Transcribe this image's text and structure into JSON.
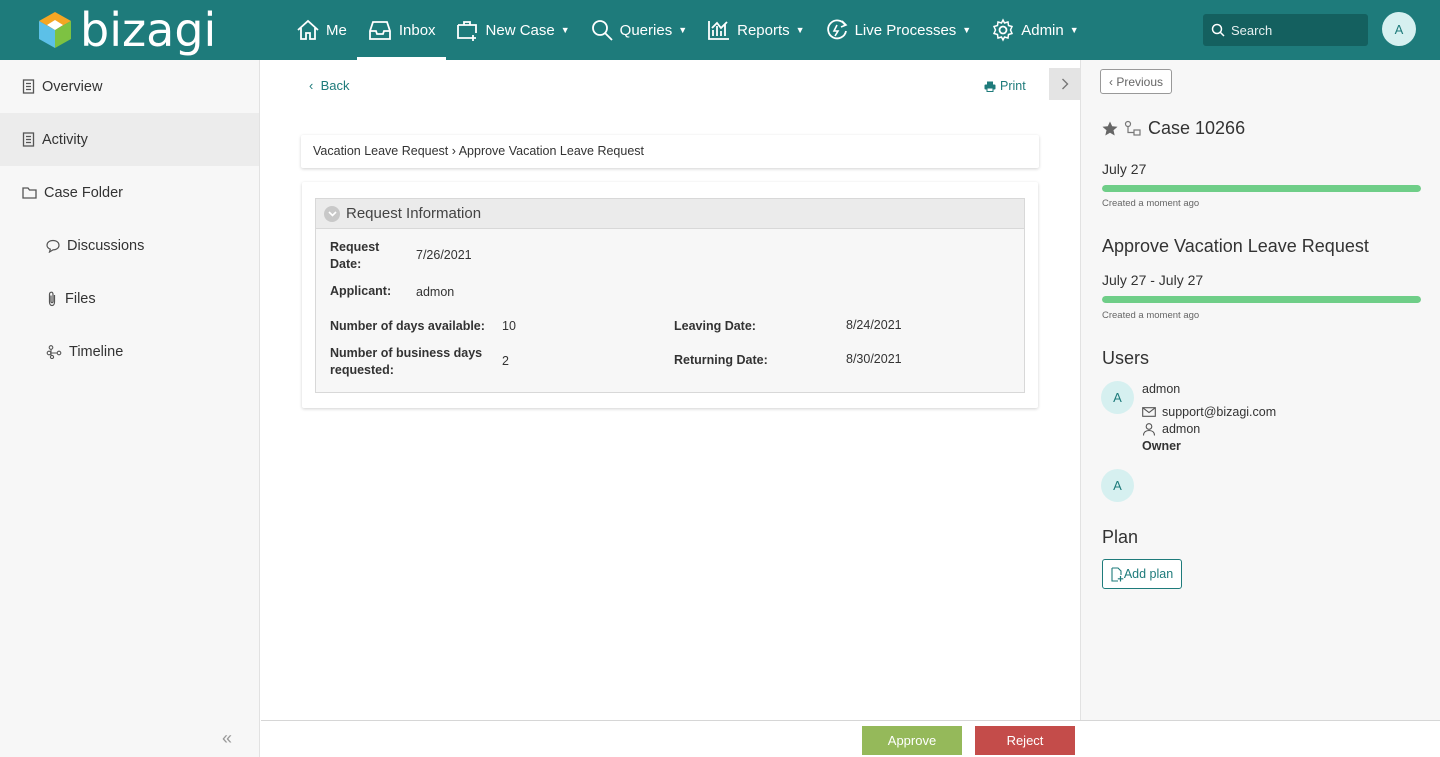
{
  "app": {
    "logo_text": "bizagi"
  },
  "nav": {
    "items": [
      {
        "label": "Me",
        "icon": "home-icon"
      },
      {
        "label": "Inbox",
        "icon": "inbox-icon",
        "active": true
      },
      {
        "label": "New Case",
        "icon": "new-case-icon",
        "dropdown": true
      },
      {
        "label": "Queries",
        "icon": "search-icon",
        "dropdown": true
      },
      {
        "label": "Reports",
        "icon": "reports-icon",
        "dropdown": true
      },
      {
        "label": "Live Processes",
        "icon": "live-processes-icon",
        "dropdown": true
      },
      {
        "label": "Admin",
        "icon": "gear-icon",
        "dropdown": true
      }
    ],
    "search_placeholder": "Search",
    "avatar_initial": "A"
  },
  "sidebar": {
    "items": [
      {
        "label": "Overview",
        "icon": "document-icon"
      },
      {
        "label": "Activity",
        "icon": "document-icon",
        "active": true
      },
      {
        "label": "Case Folder",
        "icon": "folder-icon"
      },
      {
        "label": "Discussions",
        "icon": "chat-icon",
        "sub": true
      },
      {
        "label": "Files",
        "icon": "paperclip-icon",
        "sub": true
      },
      {
        "label": "Timeline",
        "icon": "timeline-icon",
        "sub": true
      }
    ],
    "collapse_glyph": "«"
  },
  "main": {
    "back_label": "Back",
    "print_label": "Print",
    "breadcrumb": "Vacation Leave Request › Approve Vacation Leave Request",
    "group_title": "Request Information",
    "fields": {
      "request_date_label": "Request Date:",
      "request_date_value": "7/26/2021",
      "applicant_label": "Applicant:",
      "applicant_value": "admon",
      "days_available_label": "Number of days available:",
      "days_available_value": "10",
      "business_days_label": "Number of business days requested:",
      "business_days_value": "2",
      "leaving_date_label": "Leaving Date:",
      "leaving_date_value": "8/24/2021",
      "returning_date_label": "Returning Date:",
      "returning_date_value": "8/30/2021"
    }
  },
  "actions": {
    "approve_label": "Approve",
    "reject_label": "Reject"
  },
  "panel": {
    "previous_label": "Previous",
    "case_title": "Case 10266",
    "case_date": "July 27",
    "case_progress": 1.0,
    "case_created": "Created a moment ago",
    "task_title": "Approve Vacation Leave Request",
    "task_dates": "July 27 - July 27",
    "task_progress": 1.0,
    "task_created": "Created a moment ago",
    "users_title": "Users",
    "user1": {
      "initial": "A",
      "name": "admon",
      "email": "support@bizagi.com",
      "username": "admon",
      "role": "Owner"
    },
    "user2": {
      "initial": "A"
    },
    "plan_title": "Plan",
    "add_plan_label": "Add plan"
  },
  "colors": {
    "brand": "#1e7b7b",
    "approve": "#95b95a",
    "reject": "#c44c4a",
    "progress": "#6fce88"
  }
}
